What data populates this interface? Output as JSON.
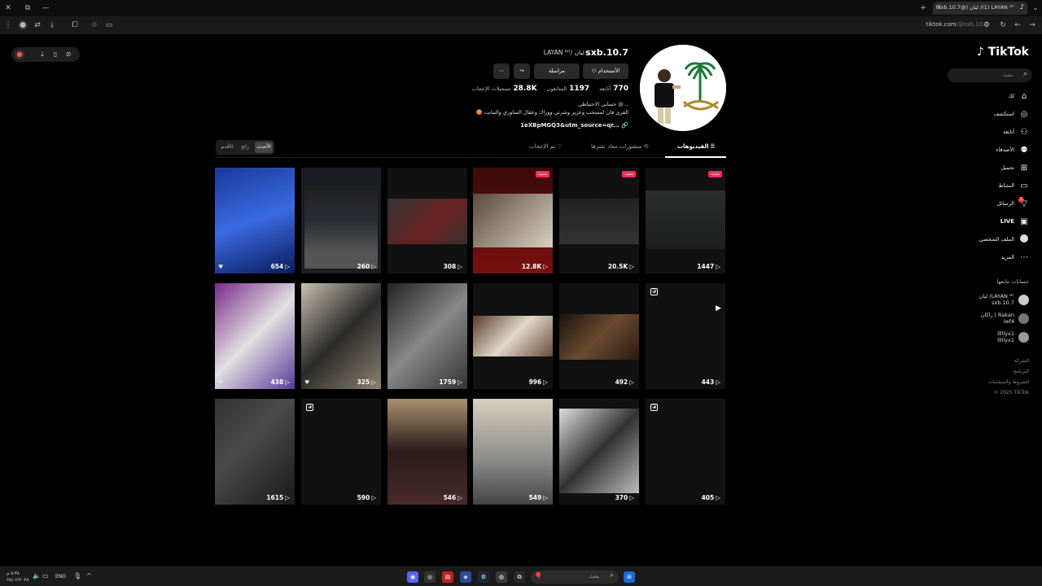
{
  "browser": {
    "tab_title": "‎(1) LAYAN ᴹᵀ/ ليان (@sxb.10.7)",
    "url_host": "tiktok.com",
    "url_path": "/@sxb.10.7"
  },
  "sidebar": {
    "logo": "TikTok",
    "search_placeholder": "بحث",
    "items": [
      {
        "label": "لك",
        "icon": "home-icon"
      },
      {
        "label": "استكشف",
        "icon": "compass-icon"
      },
      {
        "label": "أتابعه",
        "icon": "user-follow-icon"
      },
      {
        "label": "الأصدقاء",
        "icon": "friends-icon"
      },
      {
        "label": "تحميل",
        "icon": "upload-icon"
      },
      {
        "label": "النشاط",
        "icon": "activity-icon"
      },
      {
        "label": "الرسائل",
        "icon": "messages-icon"
      },
      {
        "label": "LIVE",
        "icon": "live-icon"
      },
      {
        "label": "الملف الشخصي",
        "icon": "profile-icon"
      },
      {
        "label": "المزيد",
        "icon": "more-icon"
      }
    ],
    "notification_count": "1",
    "following_heading": "حسابات تتابعها",
    "following": [
      {
        "name": "LAYAN ᴹᵀ/ ليان",
        "handle": "sxb.10.7"
      },
      {
        "name": "Rakan | راكان",
        "handle": "iwf4"
      },
      {
        "name": "lllllyx1",
        "handle": "lllllyx1"
      }
    ],
    "footer": [
      "الشركة",
      "البرنامج",
      "الشروط والسياسات",
      "© 2025 TikTok"
    ]
  },
  "profile": {
    "username": "sxb.10.7",
    "nickname": "LAYAN ᴹᵀ/ ليان",
    "buttons": {
      "following": "الأستخدام",
      "message": "مراسلة"
    },
    "stats": [
      {
        "value": "770",
        "label": "أتابعه"
      },
      {
        "value": "1197",
        "label": "المتابعون"
      },
      {
        "value": "28.8K",
        "label": "تسجيلات الإعجاب"
      }
    ],
    "bio_line1": "حسابي الاحتياطي @...",
    "bio_line2": "🍪 القرى فان لمسحب وعزيز وشرتي ووراك وعقال الساوري والبنايت",
    "bio_link": "1eXBpMGQ3&utm_source=qr..."
  },
  "content_tabs": [
    {
      "label": "الفيديوهات",
      "active": true
    },
    {
      "label": "منشورات معاد نشرها",
      "active": false
    },
    {
      "label": "تم الإعجاب",
      "active": false
    }
  ],
  "sort": [
    "الأحدث",
    "رائج",
    "الأقدم"
  ],
  "videos": [
    {
      "views": "1447",
      "pinned": "مثبت"
    },
    {
      "views": "20.5K",
      "pinned": "مثبت"
    },
    {
      "views": "12.8K",
      "pinned": "مثبت"
    },
    {
      "views": "308",
      "pinned": ""
    },
    {
      "views": "260",
      "pinned": ""
    },
    {
      "views": "654",
      "pinned": ""
    },
    {
      "views": "443",
      "pinned": ""
    },
    {
      "views": "492",
      "pinned": ""
    },
    {
      "views": "996",
      "pinned": ""
    },
    {
      "views": "1759",
      "pinned": ""
    },
    {
      "views": "325",
      "pinned": ""
    },
    {
      "views": "438",
      "pinned": ""
    },
    {
      "views": "405",
      "pinned": ""
    },
    {
      "views": "370",
      "pinned": ""
    },
    {
      "views": "549",
      "pinned": ""
    },
    {
      "views": "546",
      "pinned": ""
    },
    {
      "views": "590",
      "pinned": ""
    },
    {
      "views": "1615",
      "pinned": ""
    }
  ],
  "taskbar": {
    "search_placeholder": "بحث",
    "lang": "ENG",
    "time": "٥:٣٨ م",
    "date": "٢٥/٠٢/٢٠٢٥"
  }
}
